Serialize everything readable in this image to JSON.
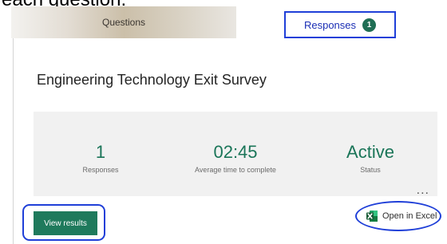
{
  "caption": "each question.",
  "tabs": {
    "questions_label": "Questions",
    "responses_label": "Responses",
    "responses_badge": "1"
  },
  "survey": {
    "title": "Engineering Technology Exit Survey"
  },
  "stats": [
    {
      "value": "1",
      "label": "Responses"
    },
    {
      "value": "02:45",
      "label": "Average time to complete"
    },
    {
      "value": "Active",
      "label": "Status"
    }
  ],
  "more_label": "...",
  "actions": {
    "view_results_label": "View results",
    "open_in_excel_label": "Open in Excel"
  },
  "colors": {
    "accent_green": "#1f7a5c",
    "highlight_blue": "#1f3fd8",
    "stat_value_green": "#1a7558"
  },
  "icons": {
    "excel": "excel-icon",
    "more": "more-options-icon"
  }
}
